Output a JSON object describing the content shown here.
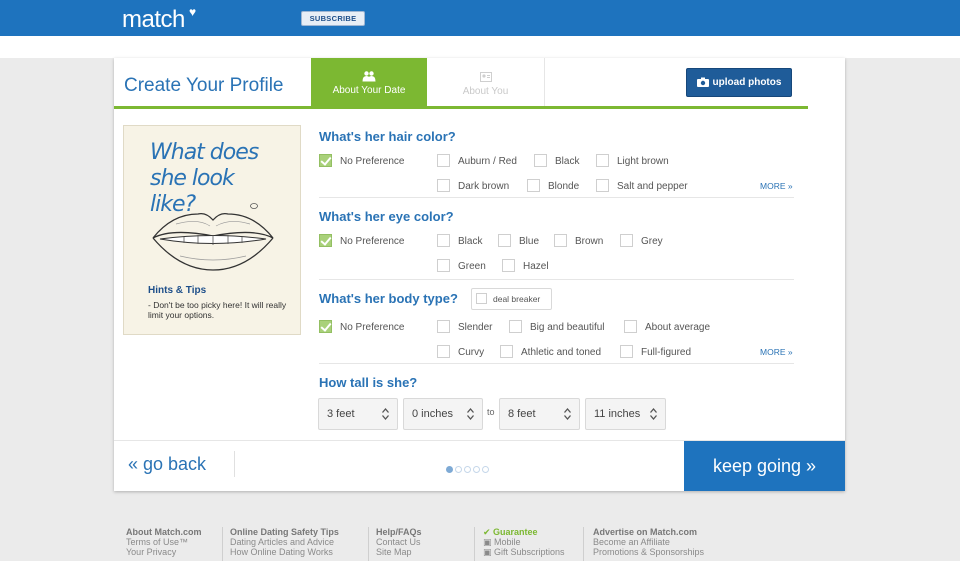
{
  "header": {
    "logo_text": "match",
    "subscribe_label": "SUBSCRIBE",
    "brand_color": "#1e73be"
  },
  "profile": {
    "title": "Create Your Profile",
    "tabs": [
      {
        "label": "About Your Date",
        "active": true
      },
      {
        "label": "About You",
        "active": false
      }
    ],
    "upload_label": "upload photos",
    "accent_color": "#7cb832"
  },
  "hint": {
    "headline": "What does she look like?",
    "title": "Hints & Tips",
    "text": "- Don't be too picky here! It will really limit your options."
  },
  "questions": {
    "hair": {
      "title": "What's her hair color?",
      "options": [
        {
          "label": "No Preference",
          "checked": true
        },
        {
          "label": "Auburn / Red",
          "checked": false
        },
        {
          "label": "Black",
          "checked": false
        },
        {
          "label": "Light brown",
          "checked": false
        },
        {
          "label": "Dark brown",
          "checked": false
        },
        {
          "label": "Blonde",
          "checked": false
        },
        {
          "label": "Salt and pepper",
          "checked": false
        }
      ],
      "more": "MORE »"
    },
    "eye": {
      "title": "What's her eye color?",
      "options": [
        {
          "label": "No Preference",
          "checked": true
        },
        {
          "label": "Black",
          "checked": false
        },
        {
          "label": "Blue",
          "checked": false
        },
        {
          "label": "Brown",
          "checked": false
        },
        {
          "label": "Grey",
          "checked": false
        },
        {
          "label": "Green",
          "checked": false
        },
        {
          "label": "Hazel",
          "checked": false
        }
      ]
    },
    "body": {
      "title": "What's her body type?",
      "deal_breaker": "deal breaker",
      "options": [
        {
          "label": "No Preference",
          "checked": true
        },
        {
          "label": "Slender",
          "checked": false
        },
        {
          "label": "Big and beautiful",
          "checked": false
        },
        {
          "label": "About average",
          "checked": false
        },
        {
          "label": "Curvy",
          "checked": false
        },
        {
          "label": "Athletic and toned",
          "checked": false
        },
        {
          "label": "Full-figured",
          "checked": false
        }
      ],
      "more": "MORE »"
    },
    "height": {
      "title": "How tall is she?",
      "from_feet": "3 feet",
      "from_inches": "0 inches",
      "to_label": "to",
      "to_feet": "8 feet",
      "to_inches": "11 inches"
    }
  },
  "nav": {
    "back": "« go back",
    "next": "keep going »",
    "steps_total": 5,
    "current_step": 1
  },
  "footer": {
    "columns": [
      {
        "header": "About Match.com",
        "links": [
          "Terms of Use™",
          "Your Privacy"
        ]
      },
      {
        "header": "Online Dating Safety Tips",
        "links": [
          "Dating Articles and Advice",
          "How Online Dating Works"
        ]
      },
      {
        "header": "Help/FAQs",
        "links": [
          "Contact Us",
          "Site Map"
        ]
      },
      {
        "header": "Guarantee",
        "links": [
          "Mobile",
          "Gift Subscriptions"
        ]
      },
      {
        "header": "Advertise on Match.com",
        "links": [
          "Become an Affiliate",
          "Promotions & Sponsorships"
        ]
      }
    ]
  }
}
